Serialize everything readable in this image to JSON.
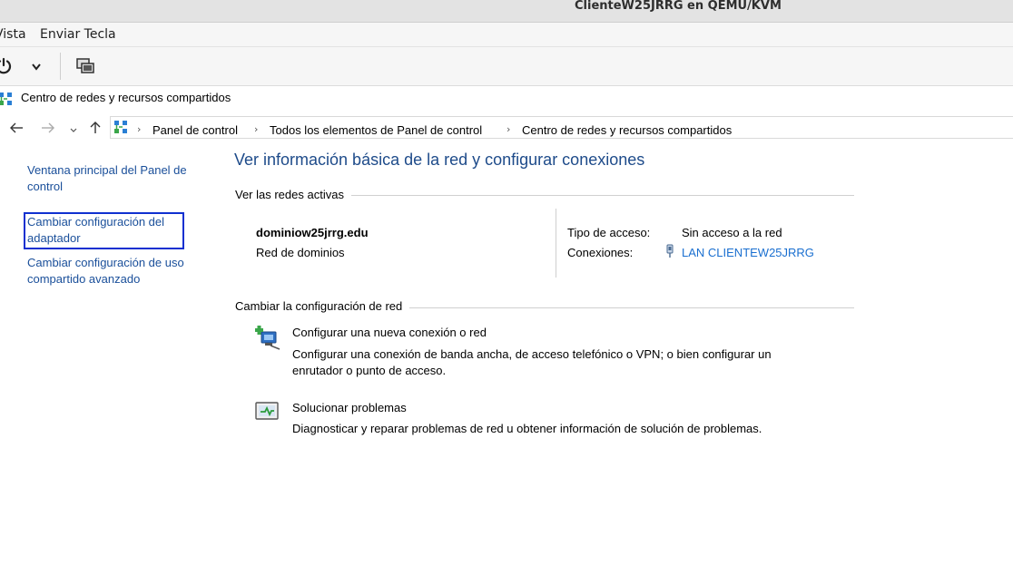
{
  "host": {
    "title": "ClienteW25JRRG en QEMU/KVM",
    "menu": [
      "Vista",
      "Enviar Tecla"
    ],
    "toolbar": {
      "power_icon": "power-icon",
      "dropdown_icon": "chevron-down-icon",
      "console_icon": "screens-icon"
    }
  },
  "window": {
    "title": "Centro de redes y recursos compartidos",
    "icon": "network-center-icon"
  },
  "address": {
    "back_icon": "arrow-left-icon",
    "forward_icon": "arrow-right-icon",
    "recent_icon": "chevron-down-icon",
    "up_icon": "arrow-up-icon",
    "breadcrumbs": [
      "Panel de control",
      "Todos los elementos de Panel de control",
      "Centro de redes y recursos compartidos"
    ]
  },
  "sidebar": {
    "items": [
      "Ventana principal del Panel de control",
      "Cambiar configuración del adaptador",
      "Cambiar configuración de uso compartido avanzado"
    ]
  },
  "main": {
    "title": "Ver información básica de la red y configurar conexiones",
    "active_section": "Ver las redes activas",
    "network": {
      "name": "dominiow25jrrg.edu",
      "type": "Red de dominios",
      "access_label": "Tipo de acceso:",
      "access_value": "Sin acceso a la red",
      "connections_label": "Conexiones:",
      "connection_value": "LAN CLIENTEW25JRRG"
    },
    "change_section": "Cambiar la configuración de red",
    "tasks": [
      {
        "title": "Configurar una nueva conexión o red",
        "desc_line1": "Configurar una conexión de banda ancha, de acceso telefónico o VPN; o bien configurar un",
        "desc_line2": "enrutador o punto de acceso.",
        "icon": "new-connection-icon"
      },
      {
        "title": "Solucionar problemas",
        "desc_line1": "Diagnosticar y reparar problemas de red u obtener información de solución de problemas.",
        "icon": "troubleshoot-icon"
      }
    ]
  },
  "colors": {
    "link": "#1a4f9a",
    "title": "#1e4b8a",
    "focus": "#1030d0"
  }
}
